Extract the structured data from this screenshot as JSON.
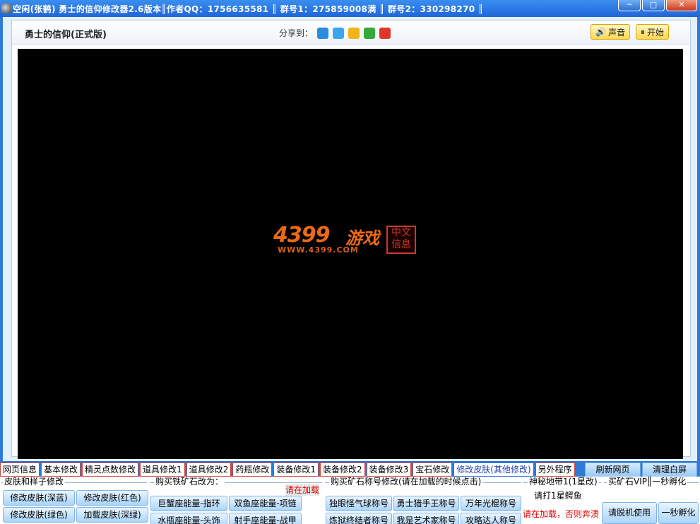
{
  "titlebar": {
    "title": "空闲(张鹤)  勇士的信仰修改器2.6版本║作者QQ：1756635581  ║  群号1：275859008满  ║  群号2：330298270  ║",
    "min_label": "─",
    "max_label": "□",
    "close_label": "✕"
  },
  "header": {
    "game_title": "勇士的信仰(正式版)",
    "share_label": "分享到：",
    "share_icons": [
      "qq-icon",
      "qzone-icon",
      "star-icon",
      "clover-icon",
      "weibo-icon"
    ],
    "sound_label": "声音",
    "start_label": "开始"
  },
  "logo": {
    "number": "4399",
    "game": "游戏",
    "url": "WWW.4399.COM",
    "seal": "中文信息"
  },
  "tabs": [
    "网页信息",
    "基本修改",
    "精灵点数修改",
    "道具修改1",
    "道具修改2",
    "药瓶修改",
    "装备修改1",
    "装备修改2",
    "装备修改3",
    "宝石修改",
    "修改皮肤(其他修改)",
    "另外程序"
  ],
  "top_buttons": {
    "refresh": "刷新网页",
    "clear": "清理白屏"
  },
  "skin_group": {
    "label": "皮肤和样子修改",
    "buttons": [
      "修改皮肤(深蓝)",
      "修改皮肤(红色)",
      "修改皮肤(绿色)",
      "加载皮肤(深绿)"
    ]
  },
  "ore_group": {
    "label": "购买铁矿石改为：",
    "loading": "请在加载",
    "buttons": [
      "巨蟹座能量-指环",
      "双鱼座能量-项链",
      "水瓶座能量-头饰",
      "射手座能量-战甲"
    ]
  },
  "title_group": {
    "label": "购买矿石称号修改(请在加载的时候点击)",
    "buttons": [
      "独眼怪气球称号",
      "勇士猎手王称号",
      "万年光棍称号",
      "炼狱终结者称号",
      "我是艺术家称号",
      "攻略达人称号"
    ]
  },
  "mystery_group": {
    "label": "神秘地带1(1星改)",
    "note": "请打1星鳄鱼",
    "warning": "请在加载，否则奔溃"
  },
  "vip_group": {
    "label": "买矿石VIP║一秒孵化",
    "offline": "请脱机使用",
    "hatch": "一秒孵化"
  }
}
